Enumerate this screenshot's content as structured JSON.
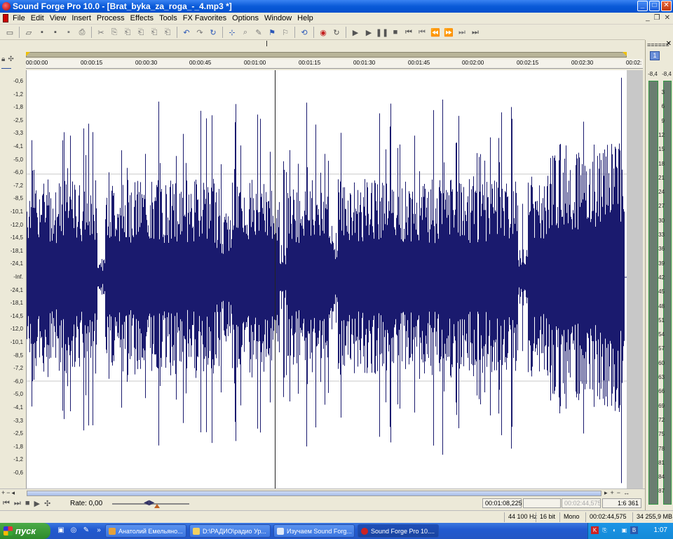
{
  "window": {
    "title": "Sound Forge Pro 10.0 - [Brat_byka_za_roga_-_4.mp3 *]",
    "buttons": {
      "minimize": "_",
      "maximize": "□",
      "close": "✕"
    }
  },
  "menu": {
    "items": [
      "File",
      "Edit",
      "View",
      "Insert",
      "Process",
      "Effects",
      "Tools",
      "FX Favorites",
      "Options",
      "Window",
      "Help"
    ],
    "mdi": {
      "minimize": "_",
      "restore": "❐",
      "close": "✕"
    }
  },
  "ruler": {
    "labels": [
      "00:00:00",
      "00:00:15",
      "00:00:30",
      "00:00:45",
      "00:01:00",
      "00:01:15",
      "00:01:30",
      "00:01:45",
      "00:02:00",
      "00:02:15",
      "00:02:30",
      "00:02:"
    ]
  },
  "db_scale": {
    "labels": [
      "-0,6",
      "-1,2",
      "-1,8",
      "-2,5",
      "-3,3",
      "-4,1",
      "-5,0",
      "-6,0",
      "-7,2",
      "-8,5",
      "-10,1",
      "-12,0",
      "-14,5",
      "-18,1",
      "-24,1",
      "-Inf.",
      "-24,1",
      "-18,1",
      "-14,5",
      "-12,0",
      "-10,1",
      "-8,5",
      "-7,2",
      "-6,0",
      "-5,0",
      "-4,1",
      "-3,3",
      "-2,5",
      "-1,8",
      "-1,2",
      "-0,6"
    ]
  },
  "channel_badge": "1",
  "meter": {
    "header": "≡≡≡≡≡≡",
    "close": "✕",
    "channel": "1",
    "peak_left": "-8,4",
    "peak_right": "-8,4",
    "scale": [
      "3",
      "6",
      "9",
      "12",
      "15",
      "18",
      "21",
      "24",
      "27",
      "30",
      "33",
      "36",
      "39",
      "42",
      "45",
      "48",
      "51",
      "54",
      "57",
      "60",
      "63",
      "66",
      "69",
      "72",
      "75",
      "78",
      "81",
      "84",
      "87"
    ]
  },
  "transport": {
    "rate_label": "Rate: 0,00",
    "cursor_position": "00:01:08,225",
    "selection_start": "",
    "selection_length": "00:02:44,575",
    "zoom": "1:6 361"
  },
  "status": {
    "sample_rate": "44 100 Hz",
    "bit_depth": "16 bit",
    "channels": "Mono",
    "length": "00:02:44,575",
    "disk_space": "34 255,9 MB"
  },
  "taskbar": {
    "start": "пуск",
    "tasks": [
      {
        "label": "Анатолий Емельяно...",
        "color": "#e4a13a"
      },
      {
        "label": "D:\\РАДИО\\радио Ур...",
        "color": "#f2d060"
      },
      {
        "label": "Изучаем Sound Forg...",
        "color": "#dfe8f6"
      },
      {
        "label": "Sound Forge Pro 10....",
        "color": "#c22"
      }
    ],
    "tray_time": "1:07",
    "tray_icons": [
      "K",
      "⎘",
      "◐",
      "▣",
      "B"
    ]
  },
  "waveform": {
    "color": "#1a1a6e",
    "cursor_time": "00:01:08,225",
    "total_length": "00:02:44,575"
  }
}
